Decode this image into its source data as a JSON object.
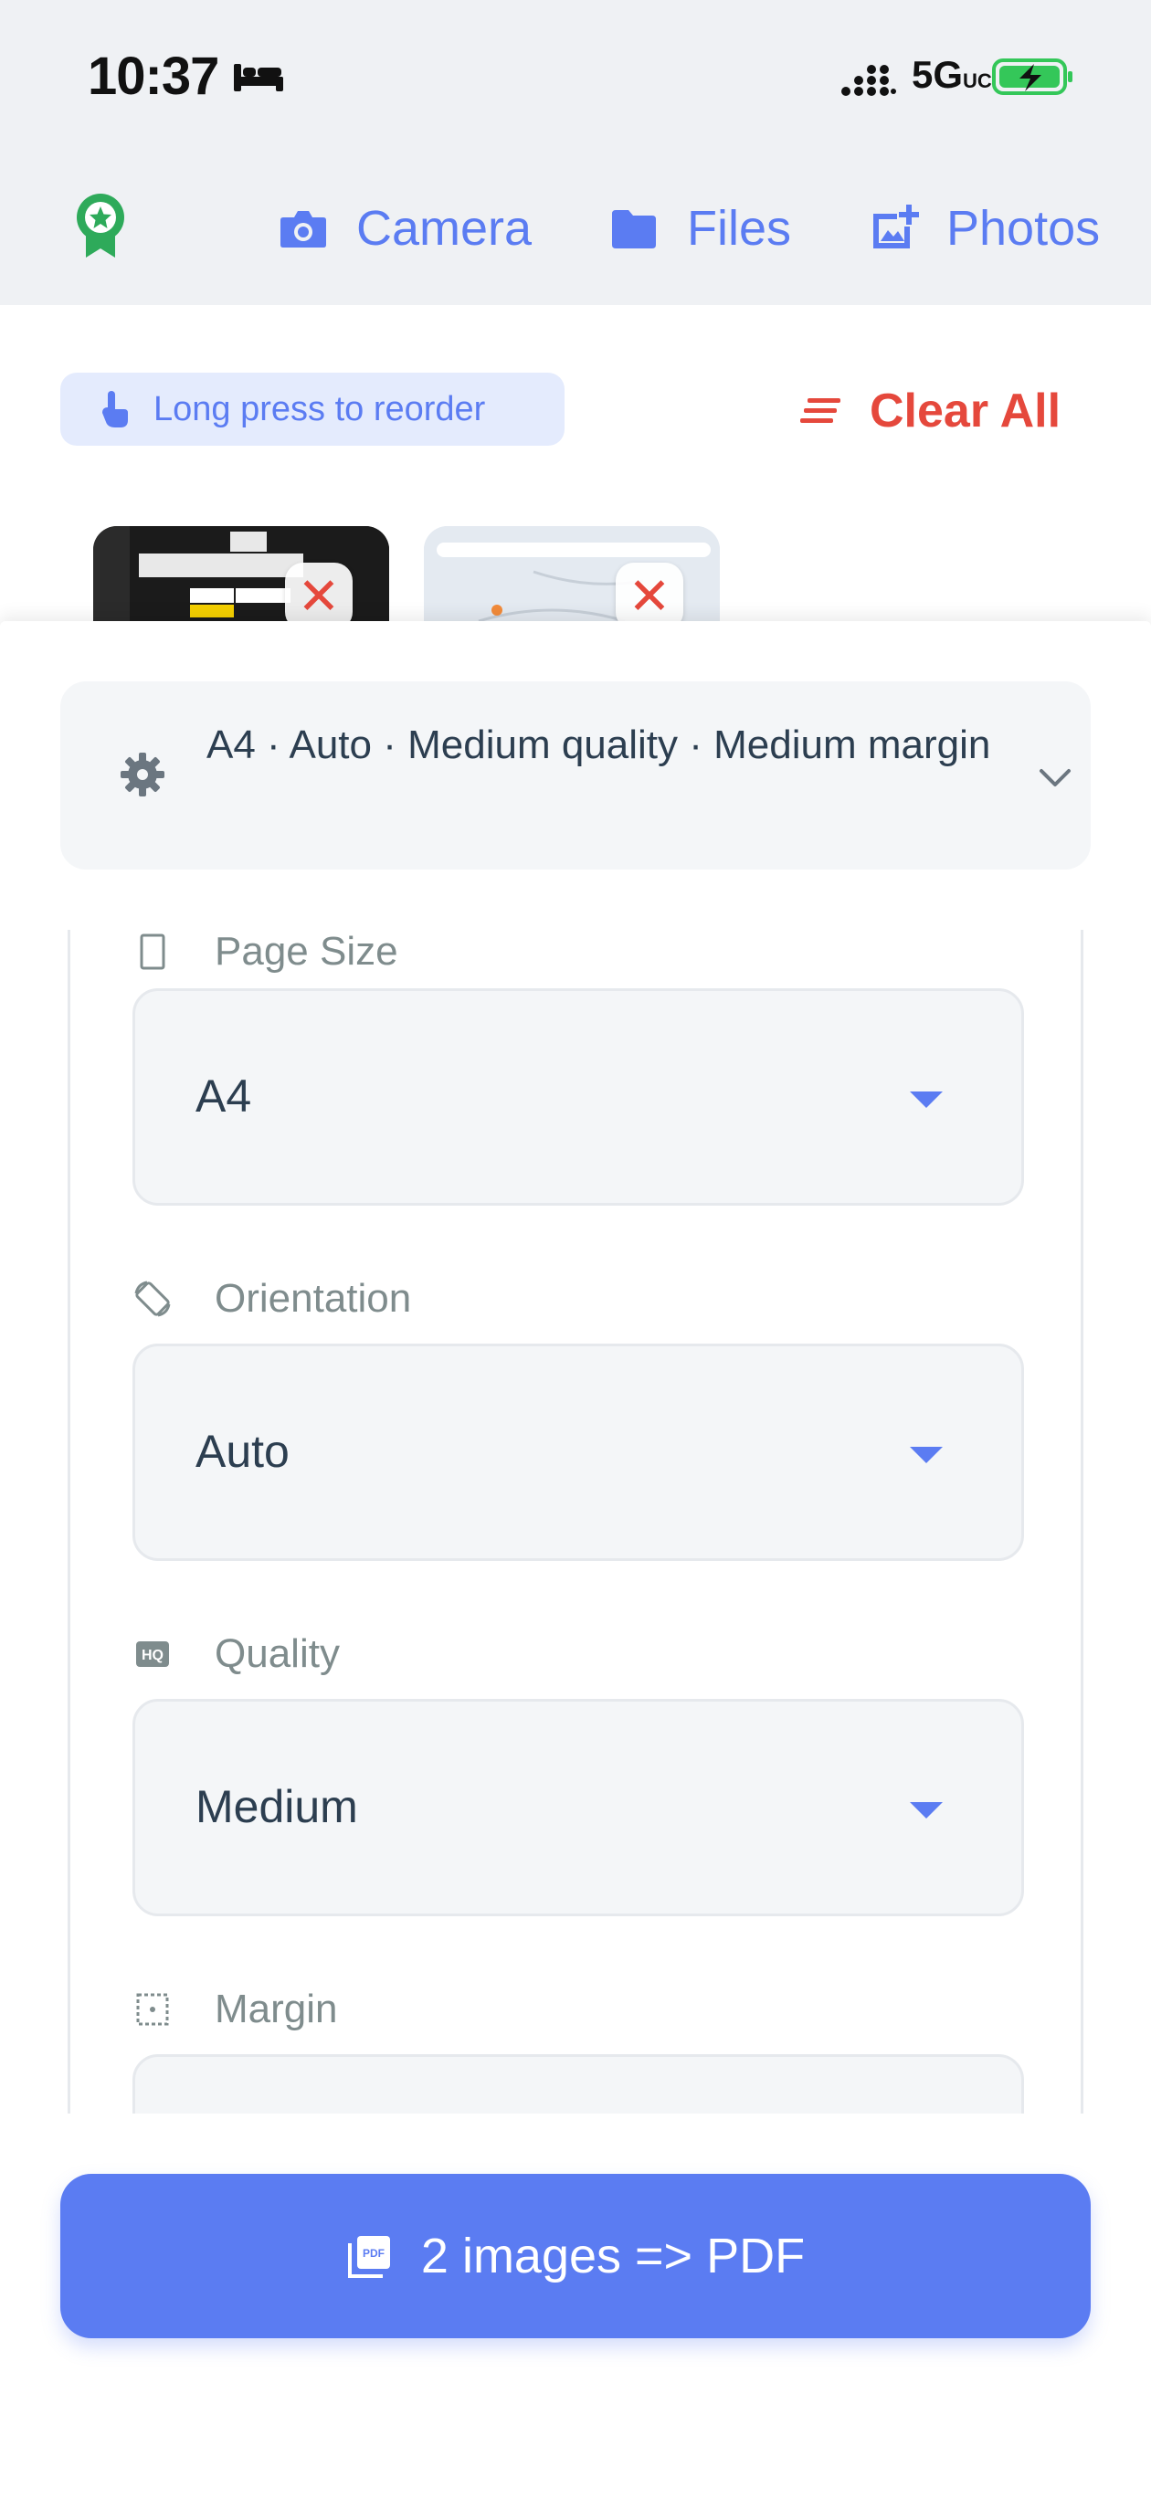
{
  "status": {
    "time": "10:37",
    "network": "5G",
    "network_suffix": "UC"
  },
  "toolbar": {
    "camera_label": "Camera",
    "files_label": "Files",
    "photos_label": "Photos"
  },
  "images_header": {
    "reorder_hint": "Long press to reorder",
    "clear_all_label": "Clear All"
  },
  "thumbnails": [
    {
      "remove_label": "✕"
    },
    {
      "remove_label": "✕"
    }
  ],
  "settings": {
    "summary": "A4 · Auto · Medium quality · Medium margin",
    "page_size": {
      "label": "Page Size",
      "value": "A4"
    },
    "orientation": {
      "label": "Orientation",
      "value": "Auto"
    },
    "quality": {
      "label": "Quality",
      "value": "Medium"
    },
    "margin": {
      "label": "Margin",
      "value": ""
    }
  },
  "convert": {
    "label": "2 images => PDF"
  },
  "colors": {
    "accent": "#5b7cf2",
    "danger": "#e5483c",
    "badge": "#2eaa5a",
    "battery": "#34c759"
  }
}
